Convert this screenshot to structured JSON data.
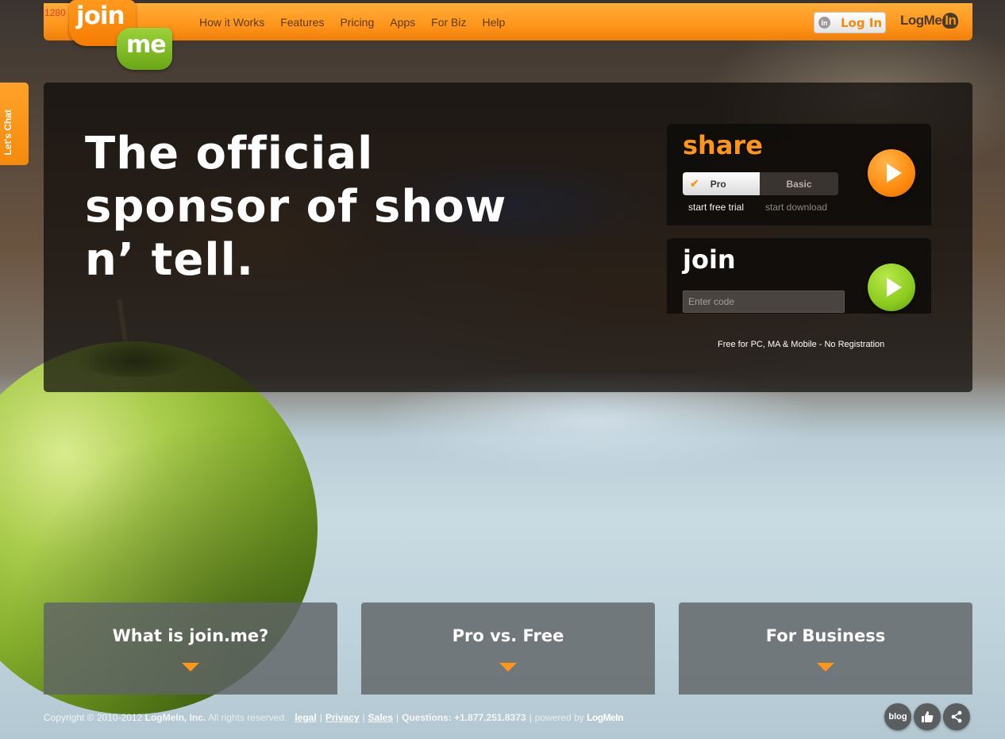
{
  "header": {
    "ruler_label": "1280",
    "logo": {
      "part1": "join",
      "part2": "me"
    },
    "nav": [
      "How it Works",
      "Features",
      "Pricing",
      "Apps",
      "For Biz",
      "Help"
    ],
    "login": {
      "icon_text": "In",
      "label": "Log In"
    },
    "brand": {
      "text": "LogMe",
      "suffix": "In"
    }
  },
  "chat_tab": {
    "label": "Let's Chat"
  },
  "hero": {
    "title": "The official sponsor of show n’ tell."
  },
  "share_card": {
    "title": "share",
    "toggle": {
      "pro": "Pro",
      "basic": "Basic",
      "selected": "Pro"
    },
    "sub_pro": "start free trial",
    "sub_basic": "start download"
  },
  "join_card": {
    "title": "join",
    "code_placeholder": "Enter code",
    "note": "Free for PC, MA & Mobile - No Registration"
  },
  "tiles": [
    {
      "label": "What is join.me?"
    },
    {
      "label": "Pro vs. Free"
    },
    {
      "label": "For Business"
    }
  ],
  "footer": {
    "copyright": "Copyright © 2010-2012",
    "company": "LogMeIn, Inc.",
    "rights": "All rights reserved.",
    "links": [
      "legal",
      "Privacy",
      "Sales"
    ],
    "questions": "Questions: +1.877.251.8373",
    "powered_by": "powered by",
    "powered_brand": "LogMeIn",
    "buttons": [
      "blog"
    ]
  },
  "colors": {
    "accent_orange": "#ff951a",
    "accent_green": "#8ccb1e"
  }
}
